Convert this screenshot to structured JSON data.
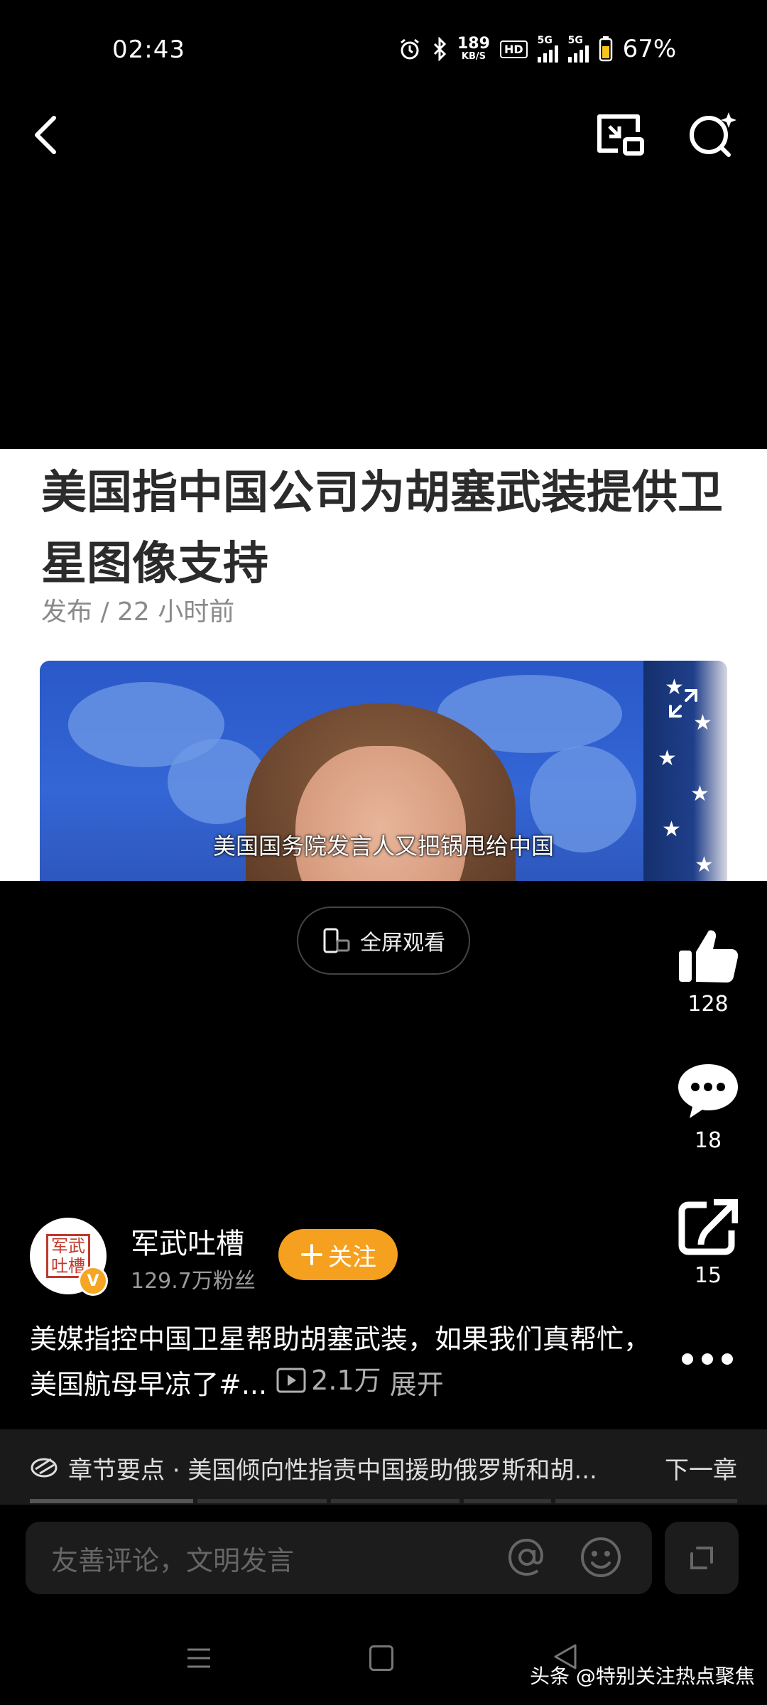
{
  "status_bar": {
    "time": "02:43",
    "net_speed_value": "189",
    "net_speed_unit": "KB/S",
    "hd_badge": "HD",
    "signal1_label": "5G",
    "signal2_label": "5G",
    "battery_percent": "67%"
  },
  "article": {
    "title": "美国指中国公司为胡塞武装提供卫星图像支持",
    "meta": "发布 / 22 小时前",
    "video_subtitle": "美国国务院发言人又把锅甩给中国"
  },
  "fullscreen_label": "全屏观看",
  "actions": {
    "like_count": "128",
    "comment_count": "18",
    "share_count": "15"
  },
  "author": {
    "name": "军武吐槽",
    "followers": "129.7万粉丝",
    "follow_label": "关注",
    "seal_text": "军武吐槽",
    "verified_mark": "V"
  },
  "description": {
    "text": "美媒指控中国卫星帮助胡塞武装，如果我们真帮忙，美国航母早凉了#...",
    "play_count": "2.1万",
    "expand_label": "展开"
  },
  "chapter": {
    "text": "章节要点 · 美国倾向性指责中国援助俄罗斯和胡...",
    "next_label": "下一章"
  },
  "comment": {
    "placeholder": "友善评论，文明发言"
  },
  "watermark": "头条 @特别关注热点聚焦",
  "colors": {
    "accent": "#f5a01e",
    "background": "#000000",
    "article_bg": "#ffffff"
  }
}
